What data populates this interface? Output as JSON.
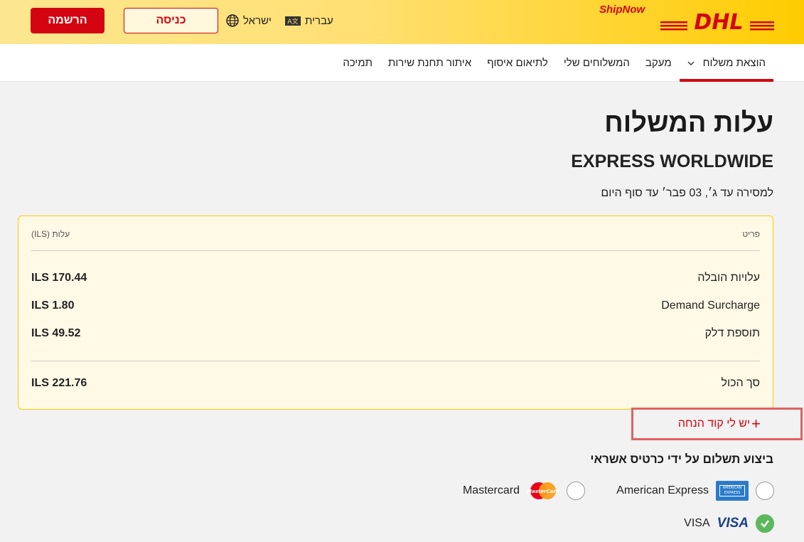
{
  "header": {
    "brand_logo_text": "DHL",
    "product_name": "ShipNow",
    "language_label": "עברית",
    "language_icon_text": "A文",
    "country_label": "ישראל",
    "login_label": "כניסה",
    "register_label": "הרשמה",
    "colors": {
      "brand_yellow": "#ffcc00",
      "brand_red": "#d40511"
    }
  },
  "nav": {
    "items": [
      {
        "label": "הוצאת משלוח",
        "active": true,
        "has_dropdown": true
      },
      {
        "label": "מעקב"
      },
      {
        "label": "המשלוחים שלי"
      },
      {
        "label": "לתיאום איסוף"
      },
      {
        "label": "איתור תחנת שירות"
      },
      {
        "label": "תמיכה"
      }
    ]
  },
  "main": {
    "title": "עלות המשלוח",
    "service_name": "EXPRESS WORLDWIDE",
    "delivery_text": "למסירה עד ג׳, 03 פבר׳ עד סוף היום"
  },
  "costs": {
    "item_header": "פריט",
    "cost_header": "עלות (ILS)",
    "rows": [
      {
        "label": "עלויות הובלה",
        "value": "ILS 170.44"
      },
      {
        "label": "Demand Surcharge",
        "value": "ILS 1.80"
      },
      {
        "label": "תוספת דלק",
        "value": "ILS 49.52"
      }
    ],
    "total": {
      "label": "סך הכול",
      "value": "ILS 221.76"
    }
  },
  "promo": {
    "label": "יש לי קוד הנחה",
    "icon": "plus-icon"
  },
  "payment": {
    "title": "ביצוע תשלום על ידי כרטיס אשראי",
    "options": [
      {
        "label": "American Express",
        "checked": false,
        "logo_text": "AMERICAN EXPRESS"
      },
      {
        "label": "Mastercard",
        "checked": false,
        "logo_text": "MasterCard"
      },
      {
        "label": "VISA",
        "checked": true,
        "logo_text": "VISA"
      }
    ]
  }
}
